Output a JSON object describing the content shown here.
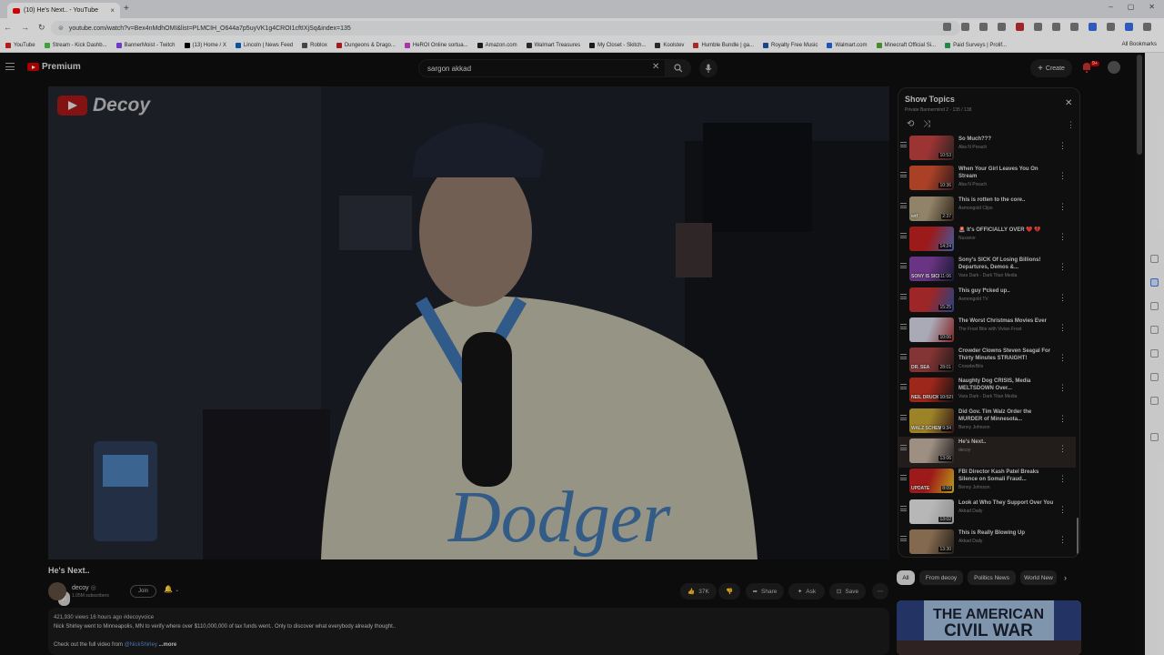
{
  "browser": {
    "tab_title": "(10) He's Next.. - YouTube",
    "url": "youtube.com/watch?v=Bex4nMdhOMI&list=PLMCIH_O644a7p5uyVK1g4CROI1cftIXjSq&index=135",
    "url_chip": "yt"
  },
  "bookmarks": [
    {
      "label": "YouTube",
      "color": "#e02020"
    },
    {
      "label": "Stream - Kick Dashb...",
      "color": "#44cc44"
    },
    {
      "label": "BannerMoist - Twitch",
      "color": "#8c45f7"
    },
    {
      "label": "(13) Home / X",
      "color": "#000000"
    },
    {
      "label": "Lincoln | News Feed",
      "color": "#0a66c2"
    },
    {
      "label": "Roblox",
      "color": "#555555"
    },
    {
      "label": "Dungeons & Drago...",
      "color": "#c81e1e"
    },
    {
      "label": "HeROI Online sortua...",
      "color": "#d040d0"
    },
    {
      "label": "Amazon.com",
      "color": "#222222"
    },
    {
      "label": "Walmart Treasures",
      "color": "#333333"
    },
    {
      "label": "My Closet - Skitch...",
      "color": "#222222"
    },
    {
      "label": "Koolstev",
      "color": "#333333"
    },
    {
      "label": "Humble Bundle | ga...",
      "color": "#cc3333"
    },
    {
      "label": "Royalty Free Music",
      "color": "#2255aa"
    },
    {
      "label": "Walmart.com",
      "color": "#2266ee"
    },
    {
      "label": "Minecraft Official Si...",
      "color": "#55aa33"
    },
    {
      "label": "Paid Surveys | Prolif...",
      "color": "#22aa55"
    }
  ],
  "all_bookmarks": "All Bookmarks",
  "masthead": {
    "logo_text": "Premium",
    "search_value": "sargon akkad",
    "create_label": "Create",
    "notif_count": "9+"
  },
  "video": {
    "channel_watermark": "Decoy",
    "title": "He's Next..",
    "channel_name": "decoy",
    "subscribers": "1.05M subscribers",
    "join_label": "Join",
    "like_count": "37K",
    "share_label": "Share",
    "ask_label": "Ask",
    "save_label": "Save"
  },
  "description": {
    "meta": "421,930 views  16 hours ago  #decoyvoice",
    "line1": "Nick Shirley went to Minneapolis, MN to verify where over $110,000,000 of tax funds went.. Only to discover what everybody already thought..",
    "line2_prefix": "Check out the full video from ",
    "line2_link": "@NickShirley",
    "more": "...more"
  },
  "playlist": {
    "title": "Show Topics",
    "subtitle": "Private  Bannermind 2 - 135 / 138",
    "items": [
      {
        "title": "So Much???",
        "channel": "Aba N Preach",
        "duration": "10:53",
        "colors": [
          "#c04040",
          "#3a2a2a"
        ]
      },
      {
        "title": "When Your Girl Leaves You On Stream",
        "channel": "Aba N Preach",
        "duration": "10:36",
        "colors": [
          "#d05030",
          "#402020"
        ]
      },
      {
        "title": "This is rotten to the core..",
        "channel": "Asmongold Clips",
        "duration": "2:37",
        "overlay": "wtf",
        "colors": [
          "#b0a080",
          "#403020"
        ]
      },
      {
        "title": "🚨 It's OFFICIALLY OVER ❤️ 💔",
        "channel": "Nuxanor",
        "duration": "14:24",
        "colors": [
          "#c02020",
          "#5070c0"
        ]
      },
      {
        "title": "Sony's SICK Of Losing Billions! Departures, Demos &...",
        "channel": "Vara Dark - Dark Titan Media",
        "duration": "11:06",
        "overlay": "SONY IS SICK",
        "colors": [
          "#8040a0",
          "#202040"
        ]
      },
      {
        "title": "This guy f*cked up..",
        "channel": "Asmongold TV",
        "duration": "15:25",
        "colors": [
          "#c03030",
          "#3050a0"
        ]
      },
      {
        "title": "The Worst Christmas Movies Ever",
        "channel": "The Frost Bite with Vivian Frost",
        "duration": "10:06",
        "colors": [
          "#d0d0e0",
          "#a03030"
        ]
      },
      {
        "title": "Crowder Clowns Steven Seagal For Thirty Minutes STRAIGHT!",
        "channel": "CrowderBits",
        "duration": "28:01",
        "overlay": "DR. SEA",
        "colors": [
          "#a04040",
          "#302020"
        ]
      },
      {
        "title": "Naughty Dog CRISIS, Media MELTSDOWN Over...",
        "channel": "Vara Dark - Dark Titan Media",
        "duration": "10:52",
        "overlay": "NEIL DRUCKMANN",
        "colors": [
          "#c03020",
          "#201818"
        ]
      },
      {
        "title": "Did Gov. Tim Walz Order the MURDER of Minnesota...",
        "channel": "Benny Johnson",
        "duration": "9:34",
        "overlay": "WALZ SCHEME?!",
        "colors": [
          "#c0a030",
          "#402020"
        ]
      },
      {
        "title": "He's Next..",
        "channel": "decoy",
        "duration": "13:06",
        "colors": [
          "#c0b0a0",
          "#302a2a"
        ],
        "active": true
      },
      {
        "title": "FBI Director Kash Patel Breaks Silence on Somali Fraud...",
        "channel": "Benny Johnson",
        "duration": "8:09",
        "overlay": "UPDATE",
        "colors": [
          "#c02020",
          "#e0c020"
        ]
      },
      {
        "title": "Look at Who They Support Over You",
        "channel": "Akkad Daily",
        "duration": "13:02",
        "colors": [
          "#e0e0e0",
          "#b0b0b0"
        ]
      },
      {
        "title": "This is Really Blowing Up",
        "channel": "Akkad Daily",
        "duration": "13:30",
        "colors": [
          "#a08060",
          "#302820"
        ]
      }
    ]
  },
  "chips": [
    "All",
    "From decoy",
    "Politics News",
    "World New"
  ],
  "recommendation": {
    "thumb_text_1": "THE AMERICAN",
    "thumb_text_2": "CIVIL WAR"
  },
  "icons": {
    "search": "search-icon",
    "mic": "mic-icon",
    "bell": "bell-icon",
    "like": "thumbs-up-icon",
    "dislike": "thumbs-down-icon",
    "share": "share-icon",
    "ask": "sparkle-icon",
    "save": "bookmark-icon",
    "more": "more-vert-icon"
  },
  "colors": {
    "brand_red": "#cc0000",
    "dim_overlay": "#0f0f0f"
  }
}
